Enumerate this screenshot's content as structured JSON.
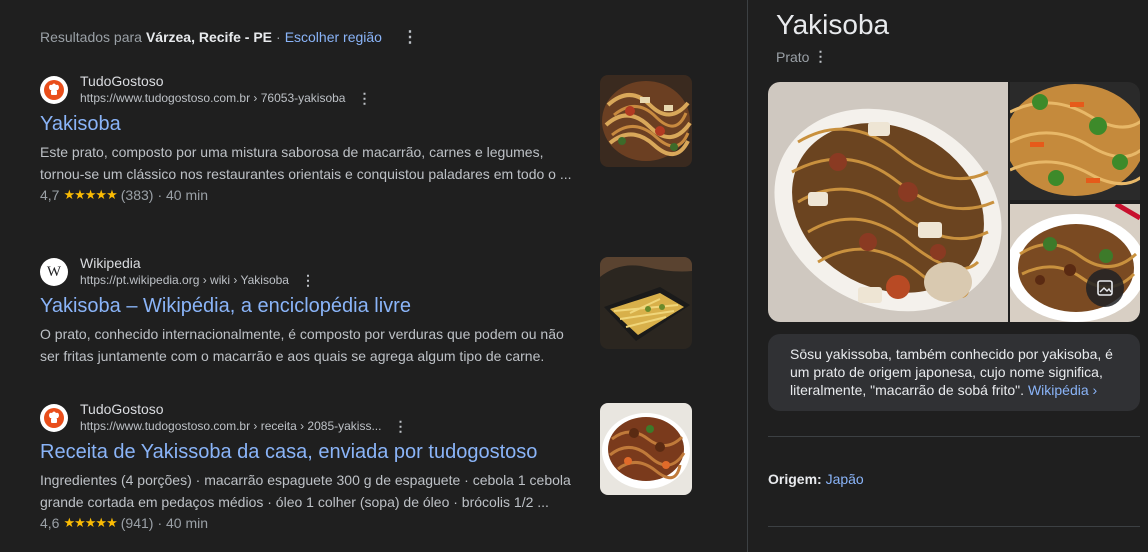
{
  "region": {
    "prefix": "Resultados para",
    "place": "Várzea, Recife - PE",
    "separator": "·",
    "change_link": "Escolher região",
    "menu_icon": "⋮"
  },
  "results": [
    {
      "site": "TudoGostoso",
      "url": "https://www.tudogostoso.com.br › 76053-yakisoba",
      "title": "Yakisoba",
      "snippet": "Este prato, composto por uma mistura saborosa de macarrão, carnes e legumes, tornou-se um clássico nos restaurantes orientais e conquistou paladares em todo o ...",
      "rating": "4,7",
      "stars": "★★★★★",
      "reviews": "(383)",
      "time": "· 40 min",
      "favicon": "chef-hat-icon"
    },
    {
      "site": "Wikipedia",
      "url": "https://pt.wikipedia.org › wiki › Yakisoba",
      "title": "Yakisoba – Wikipédia, a enciclopédia livre",
      "snippet": "O prato, conhecido internacionalmente, é composto por verduras que podem ou não ser fritas juntamente com o macarrão e aos quais se agrega algum tipo de carne.",
      "favicon_letter": "W"
    },
    {
      "site": "TudoGostoso",
      "url": "https://www.tudogostoso.com.br › receita › 2085-yakiss...",
      "title": "Receita de Yakissoba da casa, enviada por tudogostoso",
      "snippet": "Ingredientes (4 porções) · macarrão espaguete 300 g de espaguete · cebola 1 cebola grande cortada em pedaços médios · óleo 1 colher (sopa) de óleo · brócolis 1/2 ...",
      "rating": "4,6",
      "stars": "★★★★★",
      "reviews": "(941)",
      "time": "· 40 min",
      "favicon": "chef-hat-icon"
    }
  ],
  "menu_icon": "⋮",
  "knowledge_panel": {
    "title": "Yakisoba",
    "subtitle": "Prato",
    "description": "Sōsu yakissoba, também conhecido por yakisoba, é um prato de origem japonesa, cujo nome significa, literalmente, \"macarrão de sobá frito\".",
    "source_link": "Wikipédia ›",
    "origin_label": "Origem:",
    "origin_value": "Japão"
  },
  "colors": {
    "background": "#1f1f1f",
    "link": "#8ab4f8",
    "star": "#fbbc04",
    "card": "#303134"
  }
}
